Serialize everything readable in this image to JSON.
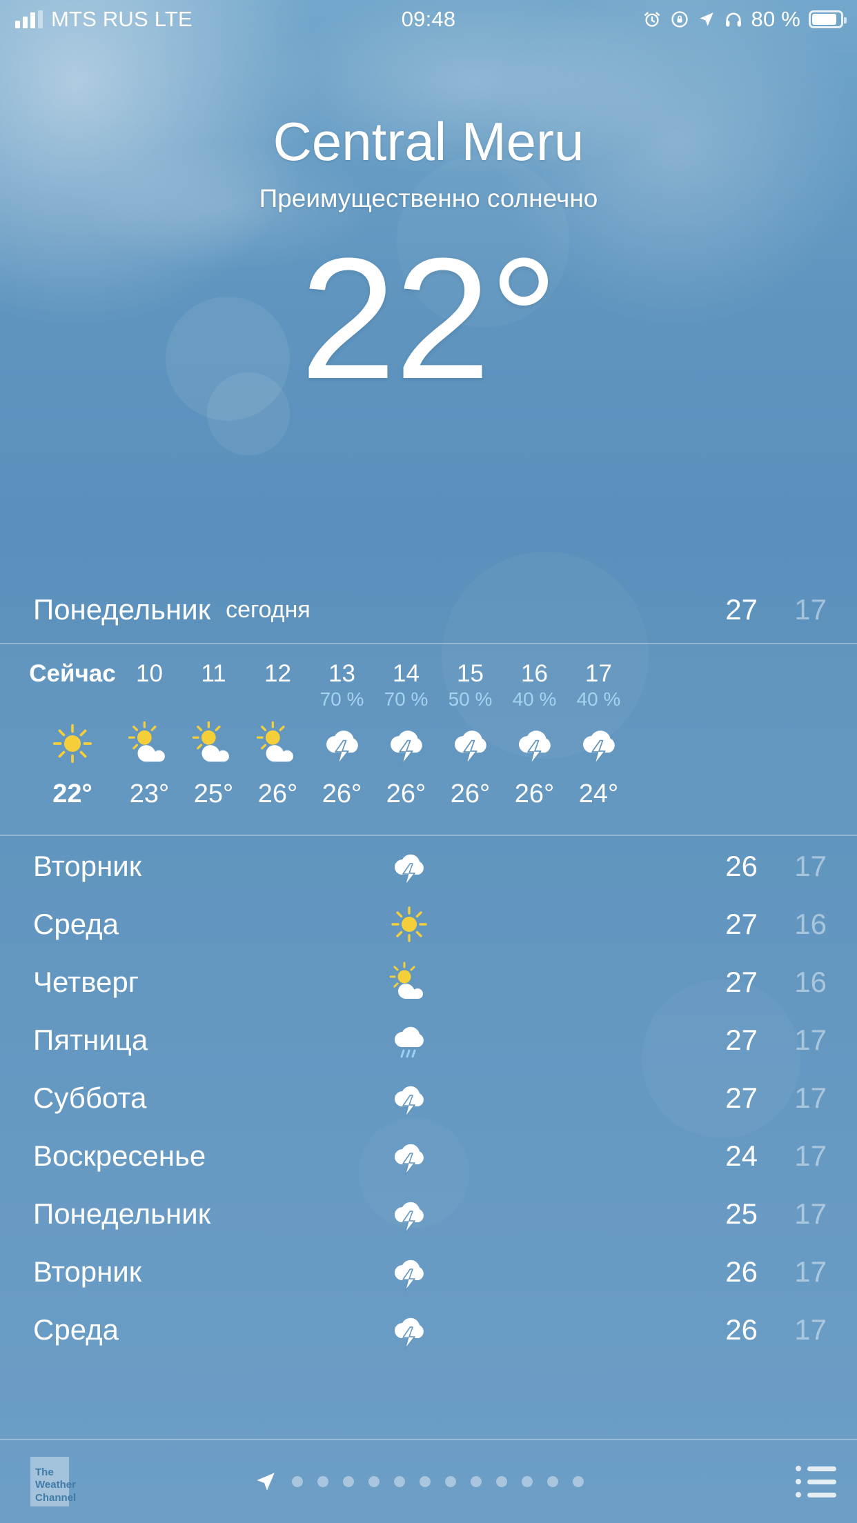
{
  "status_bar": {
    "carrier": "MTS RUS LTE",
    "time": "09:48",
    "battery_percent": "80 %",
    "icons": [
      "signal-bars-icon",
      "alarm-icon",
      "rotation-lock-icon",
      "location-arrow-icon",
      "headphones-icon",
      "battery-icon"
    ]
  },
  "hero": {
    "city": "Central Meru",
    "condition": "Преимущественно солнечно",
    "temperature": "22°"
  },
  "today": {
    "day": "Понедельник",
    "label": "сегодня",
    "high": "27",
    "low": "17"
  },
  "hourly": {
    "now_label": "Сейчас",
    "items": [
      {
        "label": "Сейчас",
        "pop": "",
        "icon": "sun-icon",
        "temp": "22°",
        "is_now": true
      },
      {
        "label": "10",
        "pop": "",
        "icon": "sun-cloud-icon",
        "temp": "23°",
        "is_now": false
      },
      {
        "label": "11",
        "pop": "",
        "icon": "sun-cloud-icon",
        "temp": "25°",
        "is_now": false
      },
      {
        "label": "12",
        "pop": "",
        "icon": "sun-cloud-icon",
        "temp": "26°",
        "is_now": false
      },
      {
        "label": "13",
        "pop": "70 %",
        "icon": "thunderstorm-icon",
        "temp": "26°",
        "is_now": false
      },
      {
        "label": "14",
        "pop": "70 %",
        "icon": "thunderstorm-icon",
        "temp": "26°",
        "is_now": false
      },
      {
        "label": "15",
        "pop": "50 %",
        "icon": "thunderstorm-icon",
        "temp": "26°",
        "is_now": false
      },
      {
        "label": "16",
        "pop": "40 %",
        "icon": "thunderstorm-icon",
        "temp": "26°",
        "is_now": false
      },
      {
        "label": "17",
        "pop": "40 %",
        "icon": "thunderstorm-icon",
        "temp": "24°",
        "is_now": false
      }
    ]
  },
  "daily": [
    {
      "day": "Вторник",
      "icon": "thunderstorm-icon",
      "high": "26",
      "low": "17"
    },
    {
      "day": "Среда",
      "icon": "sun-icon",
      "high": "27",
      "low": "16"
    },
    {
      "day": "Четверг",
      "icon": "sun-cloud-icon",
      "high": "27",
      "low": "16"
    },
    {
      "day": "Пятница",
      "icon": "rain-icon",
      "high": "27",
      "low": "17"
    },
    {
      "day": "Суббота",
      "icon": "thunderstorm-icon",
      "high": "27",
      "low": "17"
    },
    {
      "day": "Воскресенье",
      "icon": "thunderstorm-icon",
      "high": "24",
      "low": "17"
    },
    {
      "day": "Понедельник",
      "icon": "thunderstorm-icon",
      "high": "25",
      "low": "17"
    },
    {
      "day": "Вторник",
      "icon": "thunderstorm-icon",
      "high": "26",
      "low": "17"
    },
    {
      "day": "Среда",
      "icon": "thunderstorm-icon",
      "high": "26",
      "low": "17"
    }
  ],
  "bottom_bar": {
    "logo_lines": [
      "The",
      "Weather",
      "Channel"
    ],
    "current_page_icon": "location-arrow-icon",
    "page_dots": 12,
    "list_icon": "list-icon"
  },
  "colors": {
    "sky_top": "#73a7cb",
    "sky_mid": "#5a90bb",
    "sky_bottom": "#6c9ec6",
    "sun_yellow": "#f5cf39",
    "cloud_white": "#ffffff",
    "pop_blue": "#a4d2ef",
    "low_temp": "rgba(255,255,255,0.45)"
  }
}
